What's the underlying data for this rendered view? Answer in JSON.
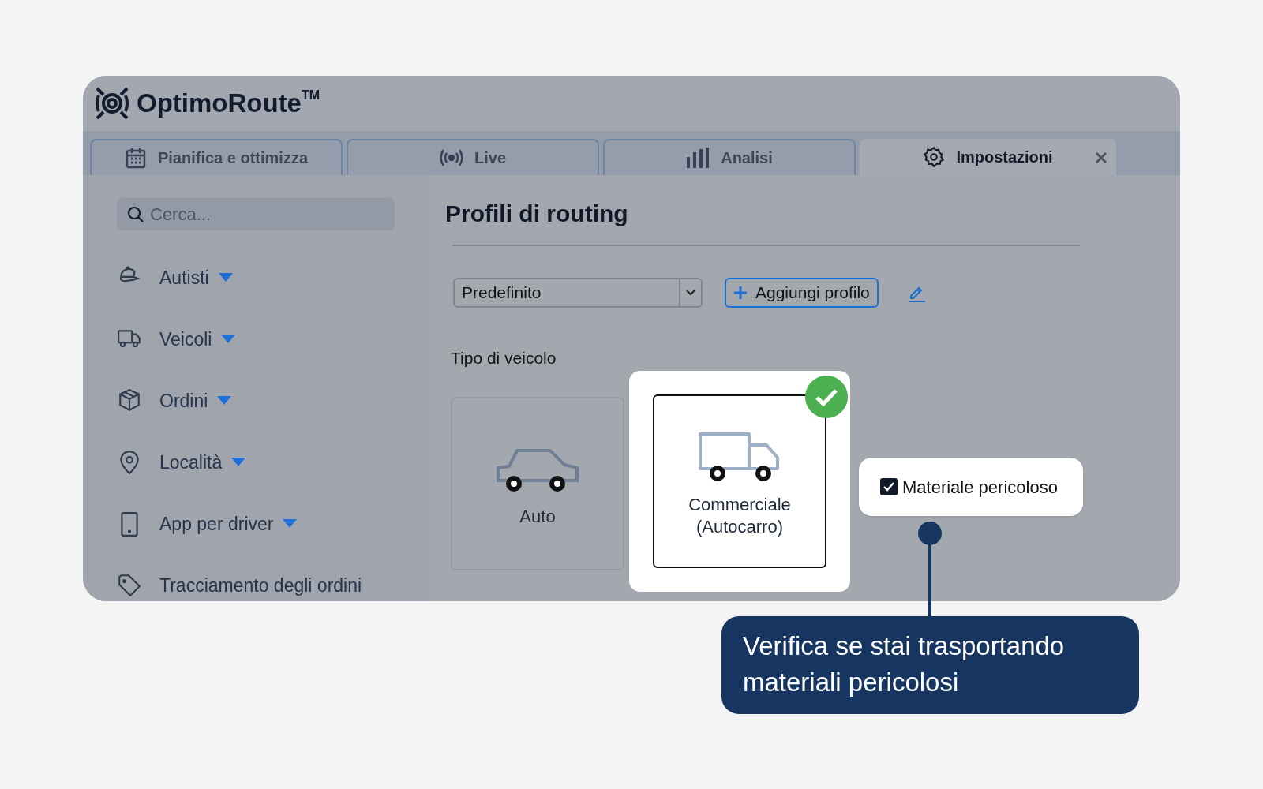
{
  "app": {
    "logo": "OptimoRoute",
    "trademark": "TM"
  },
  "tabs": [
    {
      "label": "Pianifica e ottimizza",
      "selected": false,
      "closable": false
    },
    {
      "label": "Live",
      "selected": false,
      "closable": false
    },
    {
      "label": "Analisi",
      "selected": false,
      "closable": false
    },
    {
      "label": "Impostazioni",
      "selected": true,
      "closable": true
    }
  ],
  "sidebar": {
    "search": {
      "placeholder": "Cerca..."
    },
    "items": [
      {
        "label": "Autisti",
        "expandable": true
      },
      {
        "label": "Veicoli",
        "expandable": true
      },
      {
        "label": "Ordini",
        "expandable": true
      },
      {
        "label": "Località",
        "expandable": true
      },
      {
        "label": "App per driver",
        "expandable": true
      },
      {
        "label": "Tracciamento degli ordini",
        "expandable": false
      }
    ]
  },
  "page": {
    "title": "Profili di routing",
    "profile_select": {
      "value": "Predefinito"
    },
    "add_button": "Aggiungi profilo",
    "vehicle_type_label": "Tipo di veicolo",
    "vehicle_types": [
      {
        "label": "Auto",
        "kind": "car",
        "selected": false
      },
      {
        "label": "Commerciale (Autocarro)",
        "kind": "truck",
        "selected": true
      }
    ],
    "hazardous": {
      "label": "Materiale pericoloso",
      "checked": true
    }
  },
  "tooltip": {
    "text": "Verifica se stai trasportando materiali pericolosi"
  }
}
